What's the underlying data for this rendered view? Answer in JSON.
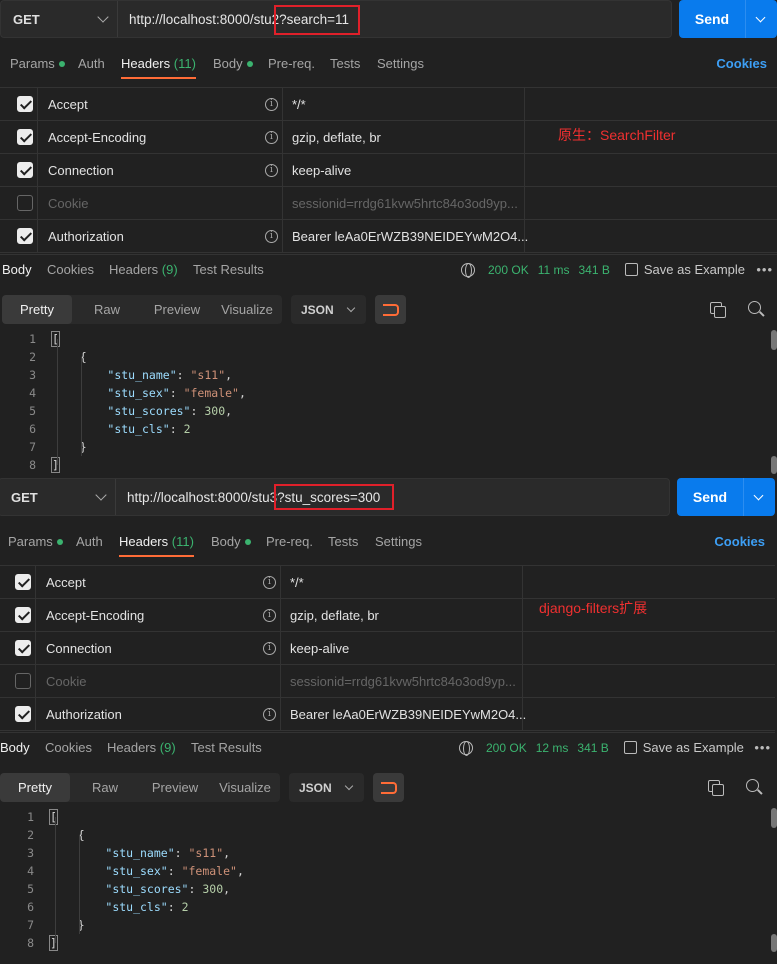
{
  "colors": {
    "send_button": "#097bed",
    "active_tab_underline": "#ff6c37",
    "success_green": "#3bb36f",
    "annotation_red": "#e0202a",
    "link_blue": "#3d9ff5"
  },
  "panels": [
    {
      "method": "GET",
      "url_base": "http://localhost:8000/stu2",
      "url_query": "?search=11",
      "send_label": "Send",
      "annotation": "原生：SearchFilter",
      "request_tabs": {
        "params": "Params",
        "auth": "Auth",
        "headers": "Headers",
        "headers_count": "(11)",
        "body": "Body",
        "prereq": "Pre-req.",
        "tests": "Tests",
        "settings": "Settings",
        "cookies": "Cookies"
      },
      "headers": [
        {
          "key": "Accept",
          "value": "*/*",
          "enabled": true
        },
        {
          "key": "Accept-Encoding",
          "value": "gzip, deflate, br",
          "enabled": true
        },
        {
          "key": "Connection",
          "value": "keep-alive",
          "enabled": true
        },
        {
          "key": "Cookie",
          "value": "sessionid=rrdg61kvw5hrtc84o3od9yp...",
          "enabled": false
        },
        {
          "key": "Authorization",
          "value": "Bearer leAa0ErWZB39NEIDEYwM2O4...",
          "enabled": true
        }
      ],
      "response_tabs": {
        "body": "Body",
        "cookies": "Cookies",
        "headers": "Headers",
        "headers_count": "(9)",
        "test_results": "Test Results"
      },
      "status": "200 OK",
      "time": "11 ms",
      "size": "341 B",
      "save_example": "Save as Example",
      "view_tabs": [
        "Pretty",
        "Raw",
        "Preview",
        "Visualize"
      ],
      "format": "JSON",
      "code": {
        "line_numbers": [
          "1",
          "2",
          "3",
          "4",
          "5",
          "6",
          "7",
          "8"
        ],
        "open_bracket": "[",
        "open_brace": "{",
        "fields": [
          {
            "key": "\"stu_name\"",
            "value": "\"s11\"",
            "kind": "string",
            "comma": ","
          },
          {
            "key": "\"stu_sex\"",
            "value": "\"female\"",
            "kind": "string",
            "comma": ","
          },
          {
            "key": "\"stu_scores\"",
            "value": "300",
            "kind": "number",
            "comma": ","
          },
          {
            "key": "\"stu_cls\"",
            "value": "2",
            "kind": "number",
            "comma": ""
          }
        ],
        "close_brace": "}",
        "close_bracket": "]"
      }
    },
    {
      "method": "GET",
      "url_base": "http://localhost:8000/stu3",
      "url_query": "?stu_scores=300",
      "send_label": "Send",
      "annotation": "django-filters扩展",
      "request_tabs": {
        "params": "Params",
        "auth": "Auth",
        "headers": "Headers",
        "headers_count": "(11)",
        "body": "Body",
        "prereq": "Pre-req.",
        "tests": "Tests",
        "settings": "Settings",
        "cookies": "Cookies"
      },
      "headers": [
        {
          "key": "Accept",
          "value": "*/*",
          "enabled": true
        },
        {
          "key": "Accept-Encoding",
          "value": "gzip, deflate, br",
          "enabled": true
        },
        {
          "key": "Connection",
          "value": "keep-alive",
          "enabled": true
        },
        {
          "key": "Cookie",
          "value": "sessionid=rrdg61kvw5hrtc84o3od9yp...",
          "enabled": false
        },
        {
          "key": "Authorization",
          "value": "Bearer leAa0ErWZB39NEIDEYwM2O4...",
          "enabled": true
        }
      ],
      "response_tabs": {
        "body": "Body",
        "cookies": "Cookies",
        "headers": "Headers",
        "headers_count": "(9)",
        "test_results": "Test Results"
      },
      "status": "200 OK",
      "time": "12 ms",
      "size": "341 B",
      "save_example": "Save as Example",
      "view_tabs": [
        "Pretty",
        "Raw",
        "Preview",
        "Visualize"
      ],
      "format": "JSON",
      "code": {
        "line_numbers": [
          "1",
          "2",
          "3",
          "4",
          "5",
          "6",
          "7",
          "8"
        ],
        "open_bracket": "[",
        "open_brace": "{",
        "fields": [
          {
            "key": "\"stu_name\"",
            "value": "\"s11\"",
            "kind": "string",
            "comma": ","
          },
          {
            "key": "\"stu_sex\"",
            "value": "\"female\"",
            "kind": "string",
            "comma": ","
          },
          {
            "key": "\"stu_scores\"",
            "value": "300",
            "kind": "number",
            "comma": ","
          },
          {
            "key": "\"stu_cls\"",
            "value": "2",
            "kind": "number",
            "comma": ""
          }
        ],
        "close_brace": "}",
        "close_bracket": "]"
      }
    }
  ]
}
